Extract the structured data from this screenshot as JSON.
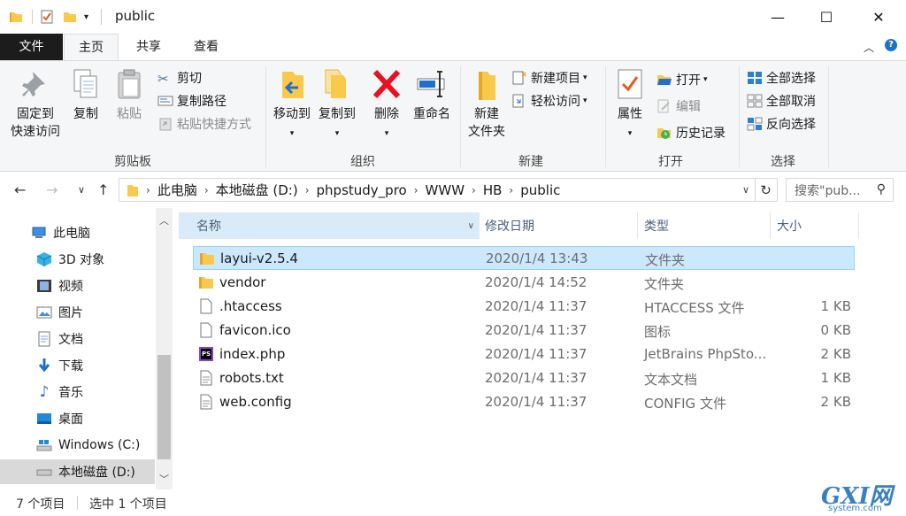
{
  "window": {
    "title": "public",
    "controls": {
      "minimize": "—",
      "maximize": "☐",
      "close": "✕"
    }
  },
  "ribbon_tabs": {
    "file": "文件",
    "home": "主页",
    "share": "共享",
    "view": "查看"
  },
  "ribbon": {
    "clipboard": {
      "label": "剪贴板",
      "pin_line1": "固定到",
      "pin_line2": "快速访问",
      "copy": "复制",
      "paste": "粘贴",
      "cut": "剪切",
      "copy_path": "复制路径",
      "paste_shortcut": "粘贴快捷方式"
    },
    "organize": {
      "label": "组织",
      "move_to": "移动到",
      "copy_to": "复制到",
      "delete": "删除",
      "rename": "重命名"
    },
    "new": {
      "label": "新建",
      "new_folder_line1": "新建",
      "new_folder_line2": "文件夹",
      "new_item": "新建项目",
      "easy_access": "轻松访问"
    },
    "open": {
      "label": "打开",
      "properties": "属性",
      "open": "打开",
      "edit": "编辑",
      "history": "历史记录"
    },
    "select": {
      "label": "选择",
      "select_all": "全部选择",
      "select_none": "全部取消",
      "invert": "反向选择"
    }
  },
  "address": {
    "crumbs": [
      "此电脑",
      "本地磁盘 (D:)",
      "phpstudy_pro",
      "WWW",
      "HB",
      "public"
    ],
    "search_placeholder": "搜索\"pub..."
  },
  "nav": {
    "items": [
      {
        "label": "此电脑",
        "icon": "computer-icon"
      },
      {
        "label": "3D 对象",
        "icon": "3d-objects-icon"
      },
      {
        "label": "视频",
        "icon": "video-icon"
      },
      {
        "label": "图片",
        "icon": "pictures-icon"
      },
      {
        "label": "文档",
        "icon": "documents-icon"
      },
      {
        "label": "下载",
        "icon": "download-icon"
      },
      {
        "label": "音乐",
        "icon": "music-icon"
      },
      {
        "label": "桌面",
        "icon": "desktop-icon"
      },
      {
        "label": "Windows (C:)",
        "icon": "drive-c-icon"
      },
      {
        "label": "本地磁盘 (D:)",
        "icon": "drive-d-icon"
      }
    ]
  },
  "list": {
    "columns": {
      "name": "名称",
      "date": "修改日期",
      "type": "类型",
      "size": "大小"
    },
    "rows": [
      {
        "name": "layui-v2.5.4",
        "date": "2020/1/4 13:43",
        "type": "文件夹",
        "size": "",
        "icon": "folder-icon"
      },
      {
        "name": "vendor",
        "date": "2020/1/4 14:52",
        "type": "文件夹",
        "size": "",
        "icon": "folder-icon"
      },
      {
        "name": ".htaccess",
        "date": "2020/1/4 11:37",
        "type": "HTACCESS 文件",
        "size": "1 KB",
        "icon": "file-icon"
      },
      {
        "name": "favicon.ico",
        "date": "2020/1/4 11:37",
        "type": "图标",
        "size": "0 KB",
        "icon": "file-icon"
      },
      {
        "name": "index.php",
        "date": "2020/1/4 11:37",
        "type": "JetBrains PhpSto...",
        "size": "2 KB",
        "icon": "phpstorm-icon"
      },
      {
        "name": "robots.txt",
        "date": "2020/1/4 11:37",
        "type": "文本文档",
        "size": "1 KB",
        "icon": "text-file-icon"
      },
      {
        "name": "web.config",
        "date": "2020/1/4 11:37",
        "type": "CONFIG 文件",
        "size": "2 KB",
        "icon": "text-file-icon"
      }
    ]
  },
  "status": {
    "count": "7 个项目",
    "selected": "选中 1 个项目"
  },
  "watermark": {
    "text": "GXI网",
    "sub": "system.com"
  },
  "colors": {
    "accent": "#0078d7",
    "selection": "#cce8ff",
    "folder": "#f8c94b",
    "delete_red": "#e81123"
  }
}
